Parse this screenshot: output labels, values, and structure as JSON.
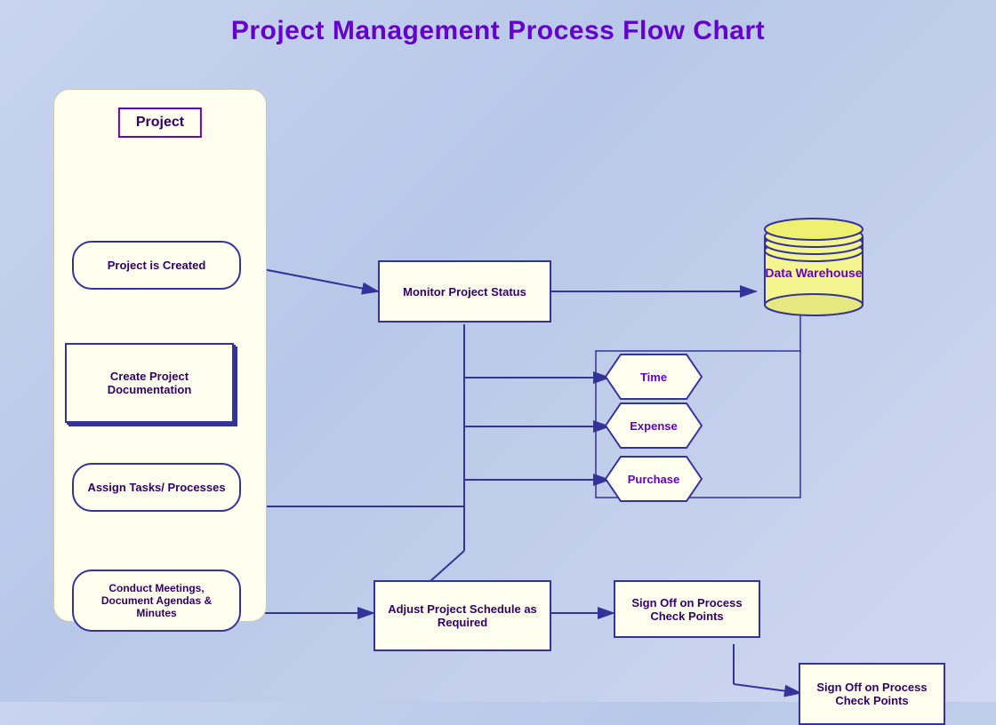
{
  "title": "Project Management Process Flow Chart",
  "lane": {
    "title": "Project"
  },
  "nodes": {
    "project_created": "Project is Created",
    "monitor_status": "Monitor Project Status",
    "data_warehouse": "Data Warehouse",
    "create_docs": "Create Project Documentation",
    "assign_tasks": "Assign Tasks/ Processes",
    "conduct_meetings": "Conduct Meetings, Document Agendas & Minutes",
    "adjust_schedule": "Adjust Project Schedule as Required",
    "sign_off_1": "Sign Off on Process Check Points",
    "sign_off_2": "Sign Off on Process Check Points",
    "time": "Time",
    "expense": "Expense",
    "purchase": "Purchase"
  },
  "colors": {
    "title": "#6600cc",
    "border": "#333399",
    "text_dark": "#330066",
    "text_purple": "#6600cc",
    "box_bg": "#fffff0",
    "lane_bg": "#fffff0",
    "cylinder_top": "#e8e87a",
    "arrow": "#333399"
  }
}
